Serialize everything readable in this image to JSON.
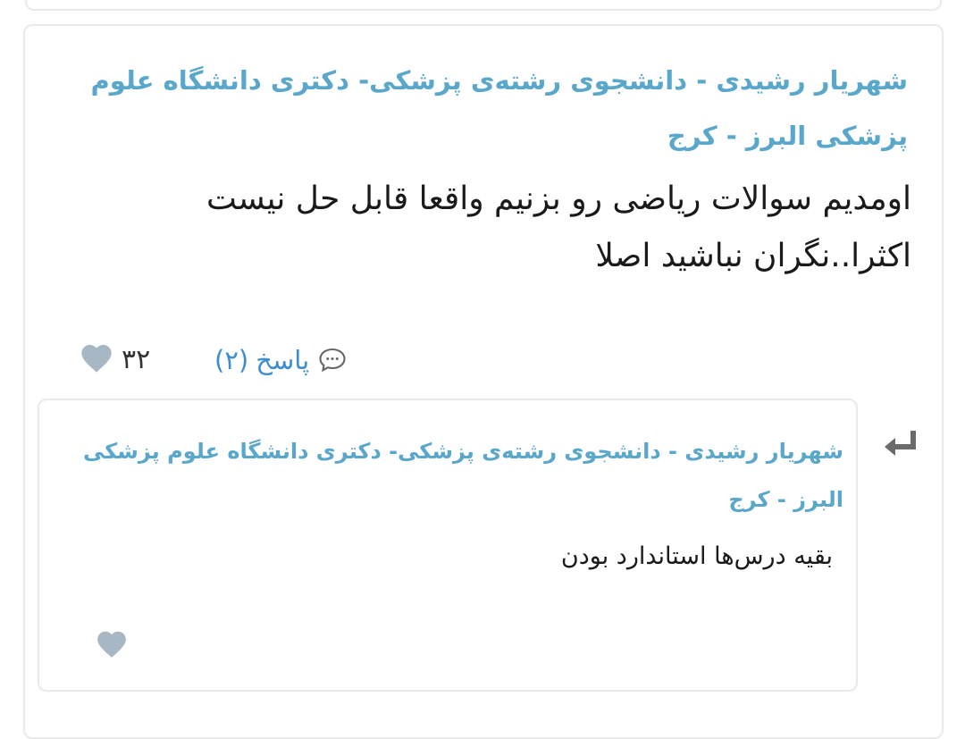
{
  "comment": {
    "author": "شهریار رشیدی - دانشجوی رشته‌ی پزشکی- دکتری دانشگاه علوم پزشکی البرز - کرج",
    "body": "اومدیم سوالات ریاضی رو بزنیم واقعا قابل حل نیست اکثرا..نگران نباشید اصلا",
    "likes": "۳۲",
    "reply_label": "پاسخ",
    "reply_count": "(۲)",
    "heart_icon": "heart-icon",
    "reply_icon": "speech-bubble-icon"
  },
  "reply": {
    "author": "شهریار رشیدی - دانشجوی رشته‌ی پزشکی- دکتری دانشگاه علوم پزشکی البرز - کرج",
    "body": "بقیه درس‌ها استاندارد بودن",
    "arrow_icon": "reply-arrow-icon",
    "heart_icon": "heart-icon"
  },
  "colors": {
    "author": "#5aa7cc",
    "link": "#3b8ed0",
    "heart": "#a7b7c4",
    "border": "#eaeaea"
  }
}
